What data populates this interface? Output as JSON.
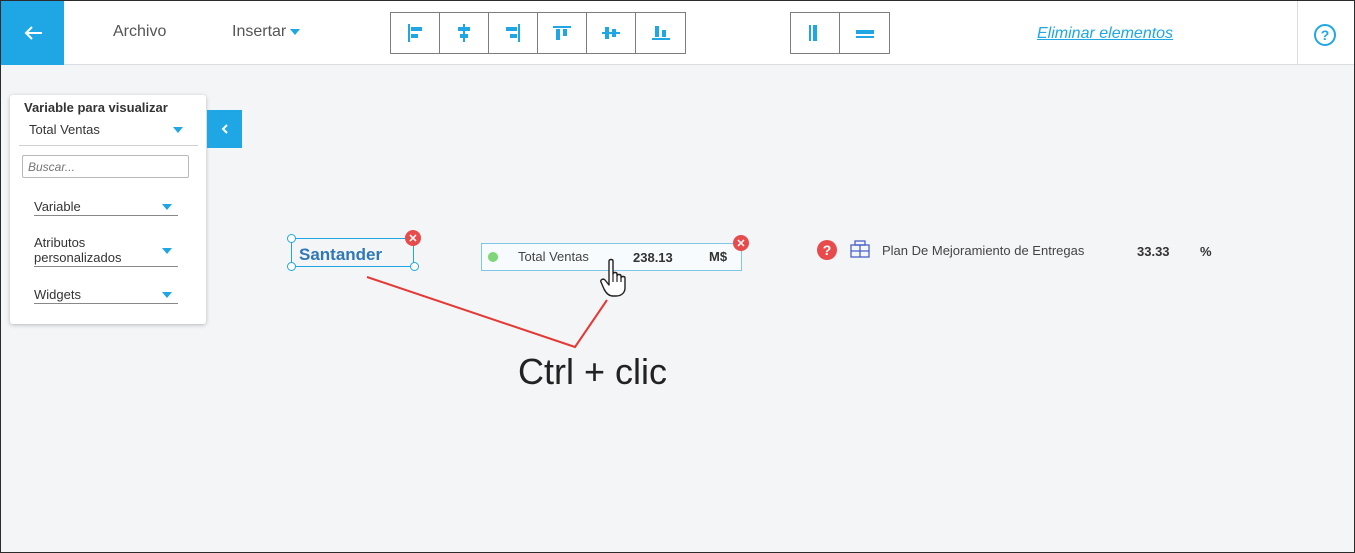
{
  "toolbar": {
    "back_icon": "arrow-left-icon",
    "archivo_label": "Archivo",
    "insertar_label": "Insertar",
    "align_buttons": [
      "align-left-icon",
      "align-center-h-icon",
      "align-right-icon",
      "align-top-icon",
      "align-middle-v-icon",
      "align-bottom-icon"
    ],
    "distribute_buttons": [
      "distribute-horizontal-icon",
      "distribute-vertical-icon"
    ],
    "eliminar_label": "Eliminar elementos",
    "help_label": "?"
  },
  "panel": {
    "title": "Variable para visualizar",
    "selected_variable": "Total Ventas",
    "search_placeholder": "Buscar...",
    "sections": [
      {
        "label": "Variable"
      },
      {
        "label": "Atributos personalizados"
      },
      {
        "label": "Widgets"
      }
    ]
  },
  "canvas": {
    "santander_label": "Santander",
    "kpi": {
      "name": "Total Ventas",
      "value": "238.13",
      "unit": "M$"
    },
    "plan": {
      "name": "Plan De Mejoramiento de Entregas",
      "value": "33.33",
      "unit": "%"
    },
    "annotation": "Ctrl + clic"
  },
  "colors": {
    "accent": "#1ea7e4",
    "danger": "#e84b4b",
    "status_green": "#7ed676",
    "annotation_red": "#e53935"
  }
}
